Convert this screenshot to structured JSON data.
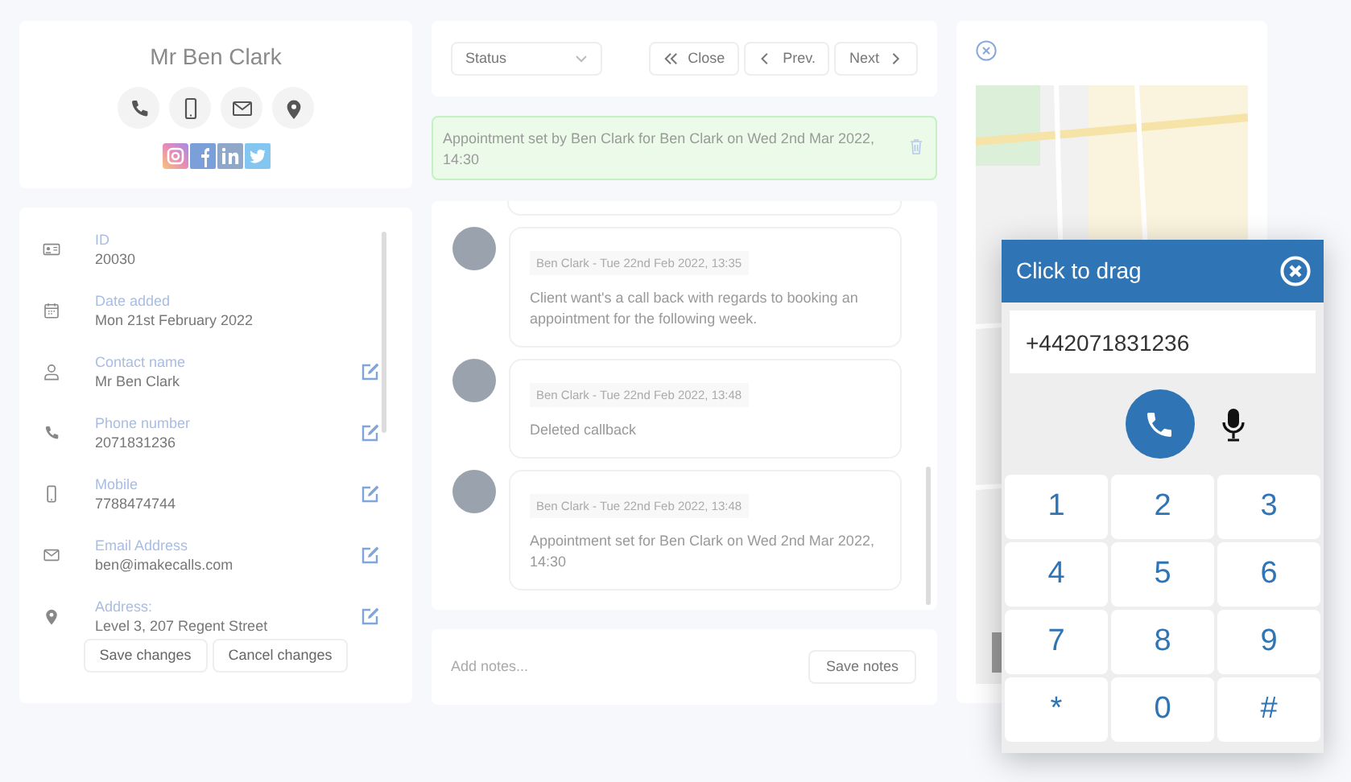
{
  "contact": {
    "name": "Mr Ben Clark"
  },
  "details": [
    {
      "kind": "id",
      "label": "ID",
      "value": "20030",
      "editable": false
    },
    {
      "kind": "date",
      "label": "Date added",
      "value": "Mon 21st February 2022",
      "editable": false
    },
    {
      "kind": "person",
      "label": "Contact name",
      "value": "Mr Ben Clark",
      "editable": true
    },
    {
      "kind": "phone",
      "label": "Phone number",
      "value": "2071831236",
      "editable": true
    },
    {
      "kind": "mobile",
      "label": "Mobile",
      "value": "7788474744",
      "editable": true
    },
    {
      "kind": "email",
      "label": "Email Address",
      "value": "ben@imakecalls.com",
      "editable": true
    },
    {
      "kind": "location",
      "label": "Address:",
      "value": "Level 3, 207 Regent Street",
      "editable": true
    }
  ],
  "detail_buttons": [
    "Save changes",
    "Cancel changes"
  ],
  "toolbar": {
    "status_placeholder": "Status",
    "buttons": [
      {
        "kind": "close",
        "label": "Close"
      },
      {
        "kind": "prev",
        "label": "Prev."
      },
      {
        "kind": "next",
        "label": "Next"
      }
    ]
  },
  "banner": {
    "text": "Appointment set by Ben Clark for Ben Clark on Wed 2nd Mar 2022, 14:30"
  },
  "notes": [
    {
      "meta": "Ben Clark - Tue 22nd Feb 2022, 13:35",
      "text": "Client want's a call back with regards to booking an appointment for the following week."
    },
    {
      "meta": "Ben Clark - Tue 22nd Feb 2022, 13:48",
      "text": "Deleted callback"
    },
    {
      "meta": "Ben Clark - Tue 22nd Feb 2022, 13:48",
      "text": "Appointment set for Ben Clark on Wed 2nd Mar 2022, 14:30"
    }
  ],
  "note_input": {
    "placeholder": "Add notes...",
    "button": "Save notes"
  },
  "dialer": {
    "title": "Click to drag",
    "number": "+442071831236",
    "keys": [
      "1",
      "2",
      "3",
      "4",
      "5",
      "6",
      "7",
      "8",
      "9",
      "*",
      "0",
      "#"
    ]
  }
}
